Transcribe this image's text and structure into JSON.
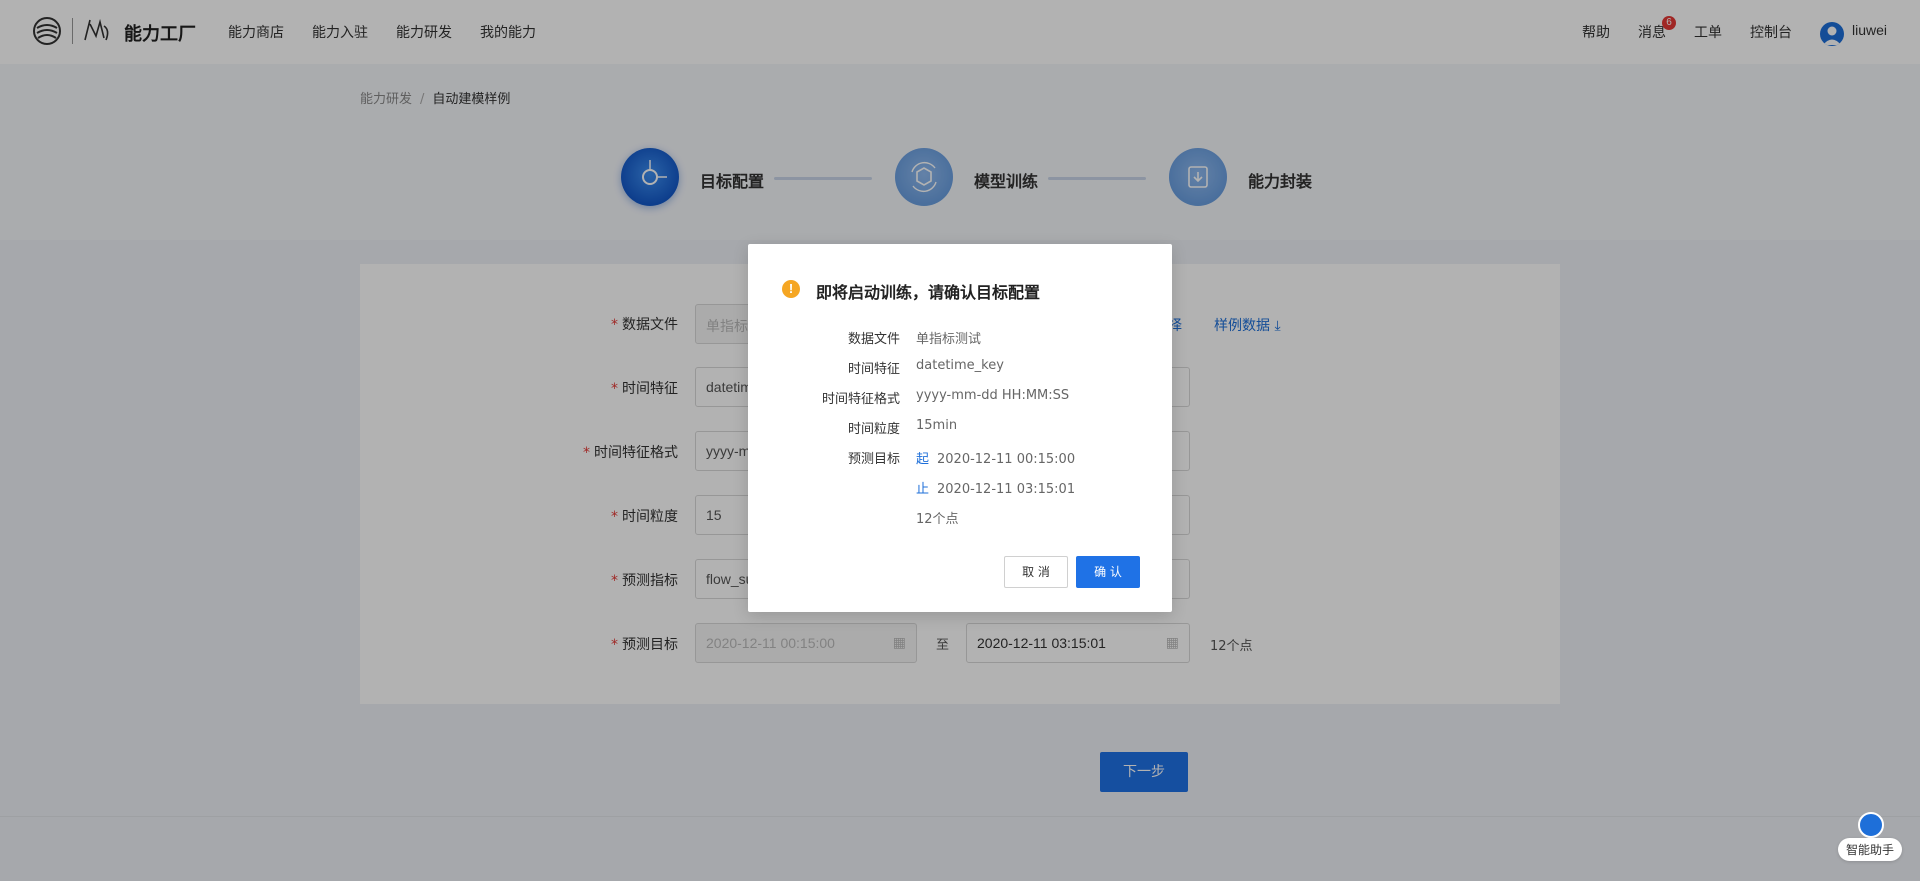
{
  "header": {
    "brand": "能力工厂",
    "nav": [
      "能力商店",
      "能力入驻",
      "能力研发",
      "我的能力"
    ],
    "help": "帮助",
    "messages": "消息",
    "message_badge": "6",
    "tickets": "工单",
    "console": "控制台",
    "username": "liuwei"
  },
  "breadcrumb": {
    "parent": "能力研发",
    "separator": "/",
    "current": "自动建模样例"
  },
  "steps": [
    {
      "label": "目标配置",
      "state": "active"
    },
    {
      "label": "模型训练",
      "state": "pending"
    },
    {
      "label": "能力封装",
      "state": "pending"
    }
  ],
  "form": {
    "data_file": {
      "label": "数据文件",
      "value": "单指标"
    },
    "time_feature": {
      "label": "时间特征",
      "value": "datetim"
    },
    "time_format": {
      "label": "时间特征格式",
      "value": "yyyy-m"
    },
    "granularity": {
      "label": "时间粒度",
      "value": "15"
    },
    "metric": {
      "label": "预测指标",
      "value": "flow_su"
    },
    "target": {
      "label": "预测目标",
      "start": "2020-12-11 00:15:00",
      "to": "至",
      "end": "2020-12-11 03:15:01",
      "points": "12个点"
    },
    "partial_link": "择",
    "sample_link": "样例数据",
    "next": "下一步"
  },
  "assistant": {
    "label": "智能助手"
  },
  "modal": {
    "title": "即将启动训练，请确认目标配置",
    "rows": [
      {
        "label": "数据文件",
        "value": "单指标测试"
      },
      {
        "label": "时间特征",
        "value": "datetime_key"
      },
      {
        "label": "时间特征格式",
        "value": "yyyy-mm-dd HH:MM:SS"
      },
      {
        "label": "时间粒度",
        "value": "15min"
      },
      {
        "label": "预测目标",
        "tag": "起",
        "value": "2020-12-11 00:15:00"
      },
      {
        "label": "",
        "tag": "止",
        "value": "2020-12-11 03:15:01"
      },
      {
        "label": "",
        "value": "12个点"
      }
    ],
    "cancel": "取 消",
    "ok": "确 认"
  },
  "colors": {
    "primary": "#1f72e6",
    "warning": "#f5a623",
    "badge": "#e53935"
  }
}
